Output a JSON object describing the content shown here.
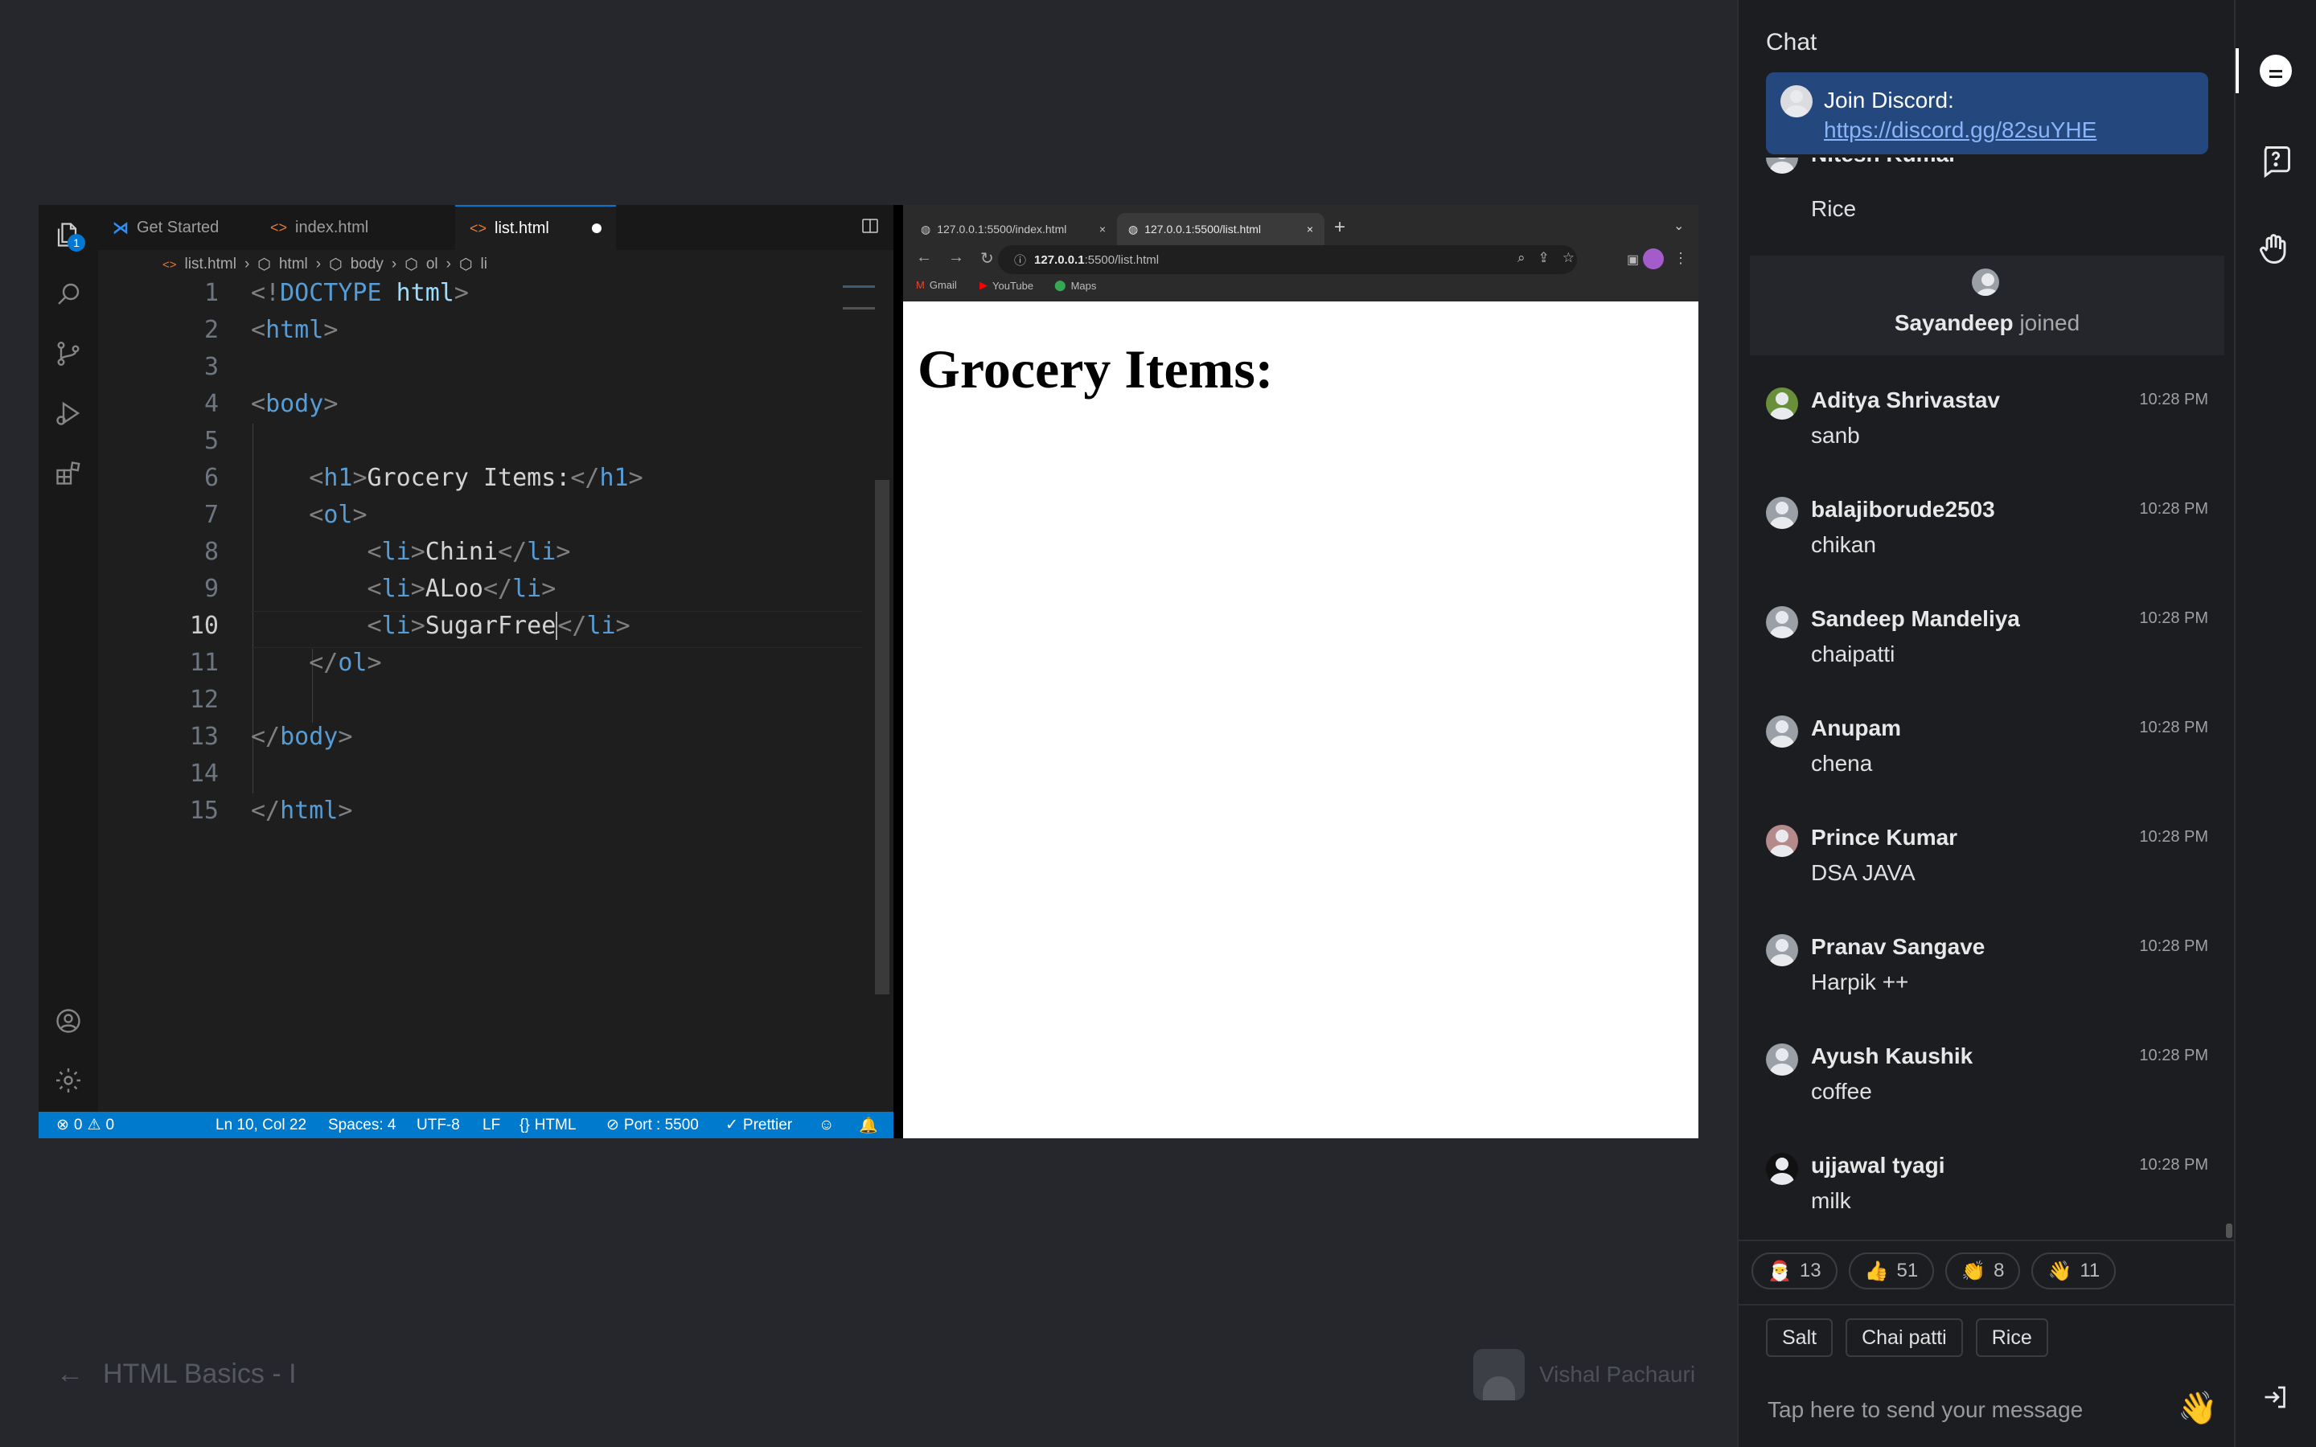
{
  "colors": {
    "accent": "#0078d4",
    "status_bar": "#007acc",
    "chat_pinned": "#24477e",
    "chat_bg": "#1c1d21"
  },
  "vscode": {
    "tabs": [
      {
        "label": "Get Started",
        "icon": "vscode-icon"
      },
      {
        "label": "index.html",
        "icon": "html-file-icon"
      },
      {
        "label": "list.html",
        "icon": "html-file-icon",
        "active": true,
        "unsaved": true
      }
    ],
    "explorer_badge": "1",
    "breadcrumbs": [
      "list.html",
      "html",
      "body",
      "ol",
      "li"
    ],
    "lines": [
      {
        "n": "1",
        "text": "<!DOCTYPE html>"
      },
      {
        "n": "2",
        "text": "<html>"
      },
      {
        "n": "3",
        "text": ""
      },
      {
        "n": "4",
        "text": "<body>"
      },
      {
        "n": "5",
        "text": ""
      },
      {
        "n": "6",
        "text": "    <h1>Grocery Items:</h1>"
      },
      {
        "n": "7",
        "text": "    <ol>"
      },
      {
        "n": "8",
        "text": "        <li>Chini</li>"
      },
      {
        "n": "9",
        "text": "        <li>ALoo</li>"
      },
      {
        "n": "10",
        "text": "        <li>SugarFree</li>",
        "current": true
      },
      {
        "n": "11",
        "text": "    </ol>"
      },
      {
        "n": "12",
        "text": ""
      },
      {
        "n": "13",
        "text": "</body>"
      },
      {
        "n": "14",
        "text": ""
      },
      {
        "n": "15",
        "text": "</html>"
      }
    ],
    "status": {
      "errors": "0",
      "warnings": "0",
      "position": "Ln 10, Col 22",
      "spaces": "Spaces: 4",
      "encoding": "UTF-8",
      "eol": "LF",
      "language": "HTML",
      "port": "Port : 5500",
      "formatter": "Prettier"
    }
  },
  "browser": {
    "tabs": [
      "127.0.0.1:5500/index.html",
      "127.0.0.1:5500/list.html"
    ],
    "url_host": "127.0.0.1",
    "url_path": ":5500/list.html",
    "bookmarks": [
      "Gmail",
      "YouTube",
      "Maps"
    ],
    "page_heading": "Grocery Items:"
  },
  "lesson": {
    "title": "HTML Basics - I",
    "presenter": "Vishal Pachauri"
  },
  "chat": {
    "title": "Chat",
    "pinned": {
      "label": "Join Discord:",
      "link": "https://discord.gg/82suYHE"
    },
    "partial_message": {
      "name": "Nitesh Kumar",
      "text": "Rice"
    },
    "join_event": {
      "name": "Sayandeep",
      "suffix": "joined"
    },
    "messages": [
      {
        "name": "Aditya Shrivastav",
        "time": "10:28 PM",
        "text": "sanb"
      },
      {
        "name": "balajiborude2503",
        "time": "10:28 PM",
        "text": "chikan"
      },
      {
        "name": "Sandeep Mandeliya",
        "time": "10:28 PM",
        "text": "chaipatti"
      },
      {
        "name": "Anupam",
        "time": "10:28 PM",
        "text": "chena"
      },
      {
        "name": "Prince Kumar",
        "time": "10:28 PM",
        "text": "DSA JAVA"
      },
      {
        "name": "Pranav Sangave",
        "time": "10:28 PM",
        "text": "Harpik ++"
      },
      {
        "name": "Ayush Kaushik",
        "time": "10:28 PM",
        "text": "coffee"
      },
      {
        "name": "ujjawal tyagi",
        "time": "10:28 PM",
        "text": "milk"
      }
    ],
    "reactions": [
      {
        "emoji": "🎅",
        "count": "13"
      },
      {
        "emoji": "👍",
        "count": "51"
      },
      {
        "emoji": "👏",
        "count": "8"
      },
      {
        "emoji": "👋",
        "count": "11"
      }
    ],
    "quick_replies": [
      "Salt",
      "Chai patti",
      "Rice"
    ],
    "input_placeholder": "Tap here to send your message",
    "wave_emoji": "👋"
  }
}
